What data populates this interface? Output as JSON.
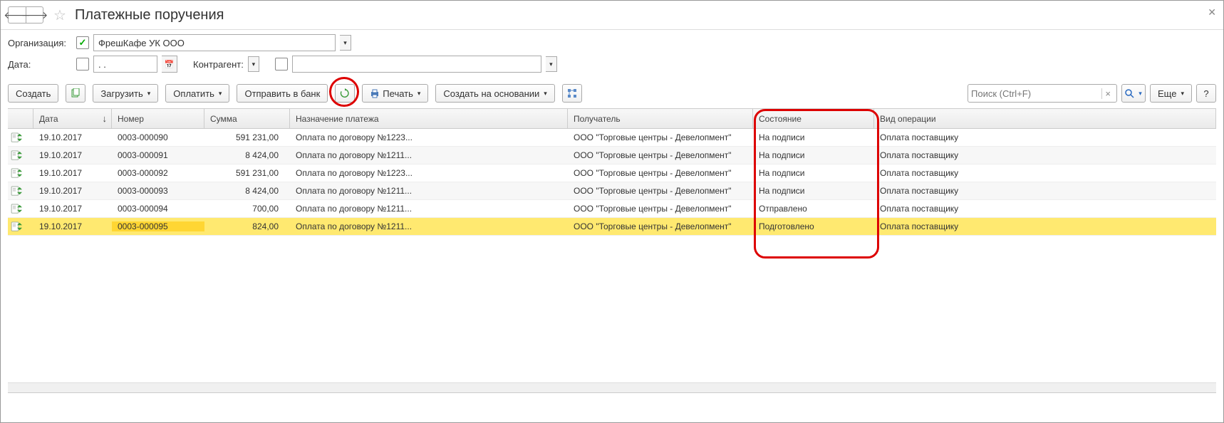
{
  "header": {
    "title": "Платежные поручения"
  },
  "filters": {
    "org_label": "Организация:",
    "org_checked": true,
    "org_value": "ФрешКафе УК ООО",
    "date_label": "Дата:",
    "date_value": ". .",
    "contr_label": "Контрагент:",
    "contr_value": ""
  },
  "toolbar": {
    "create": "Создать",
    "load": "Загрузить",
    "pay": "Оплатить",
    "send": "Отправить в банк",
    "print": "Печать",
    "create_based": "Создать на основании",
    "search_placeholder": "Поиск (Ctrl+F)",
    "more": "Еще"
  },
  "columns": {
    "date": "Дата",
    "num": "Номер",
    "sum": "Сумма",
    "purpose": "Назначение платежа",
    "recip": "Получатель",
    "state": "Состояние",
    "oper": "Вид операции"
  },
  "rows": [
    {
      "date": "19.10.2017",
      "num": "0003-000090",
      "sum": "591 231,00",
      "purpose": "Оплата по договору №1223...",
      "recip": "ООО \"Торговые центры - Девелопмент\"",
      "state": "На подписи",
      "oper": "Оплата поставщику"
    },
    {
      "date": "19.10.2017",
      "num": "0003-000091",
      "sum": "8 424,00",
      "purpose": "Оплата по договору №1211...",
      "recip": "ООО \"Торговые центры - Девелопмент\"",
      "state": "На подписи",
      "oper": "Оплата поставщику"
    },
    {
      "date": "19.10.2017",
      "num": "0003-000092",
      "sum": "591 231,00",
      "purpose": "Оплата по договору №1223...",
      "recip": "ООО \"Торговые центры - Девелопмент\"",
      "state": "На подписи",
      "oper": "Оплата поставщику"
    },
    {
      "date": "19.10.2017",
      "num": "0003-000093",
      "sum": "8 424,00",
      "purpose": "Оплата по договору №1211...",
      "recip": "ООО \"Торговые центры - Девелопмент\"",
      "state": "На подписи",
      "oper": "Оплата поставщику"
    },
    {
      "date": "19.10.2017",
      "num": "0003-000094",
      "sum": "700,00",
      "purpose": "Оплата по договору №1211...",
      "recip": "ООО \"Торговые центры - Девелопмент\"",
      "state": "Отправлено",
      "oper": "Оплата поставщику"
    },
    {
      "date": "19.10.2017",
      "num": "0003-000095",
      "sum": "824,00",
      "purpose": "Оплата по договору №1211...",
      "recip": "ООО \"Торговые центры - Девелопмент\"",
      "state": "Подготовлено",
      "oper": "Оплата поставщику"
    }
  ],
  "selected_row": 5
}
